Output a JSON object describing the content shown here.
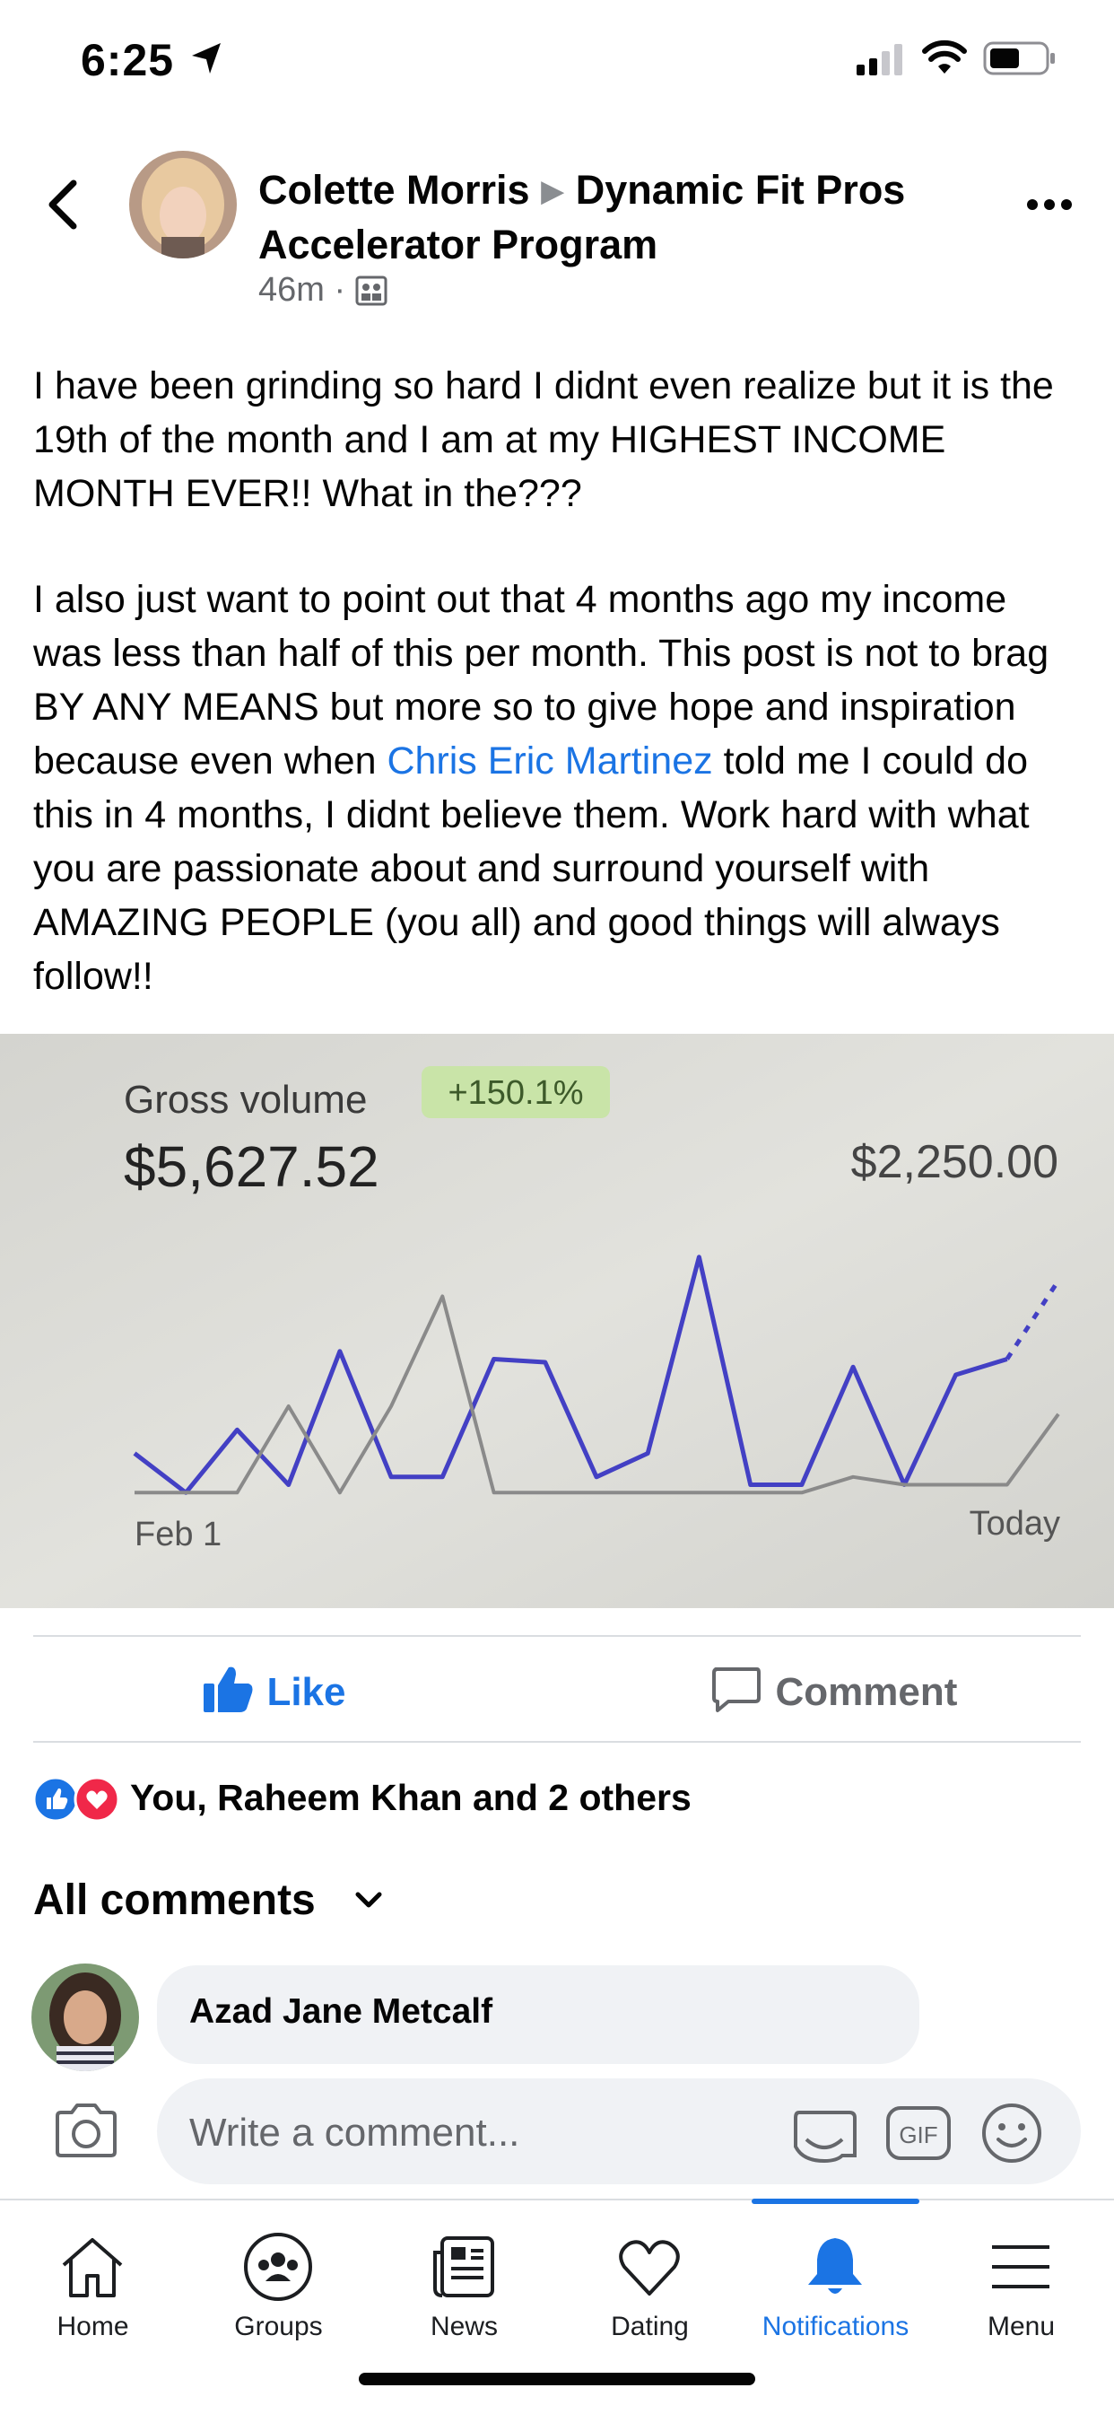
{
  "status_bar": {
    "time": "6:25"
  },
  "header": {
    "author": "Colette Morris",
    "group": "Dynamic Fit Pros Accelerator Program",
    "time_ago": "46m",
    "separator": "·"
  },
  "post": {
    "paragraph1": "I have been grinding so hard I didnt even realize but it is the 19th of the month and I am at my HIGHEST INCOME MONTH EVER!! What in the???",
    "paragraph2_before": "I also just want to point out that 4 months ago my income was less than half of this per month. This post is not to brag BY ANY MEANS but more so to give hope and inspiration because even when ",
    "mention": "Chris Eric Martinez",
    "paragraph2_after": " told me I could do this in 4 months, I didnt believe them. Work hard with what you are passionate about and surround yourself with AMAZING PEOPLE (you all) and good things will always follow!!"
  },
  "photo": {
    "label": "Gross volume",
    "badge": "+150.1%",
    "current_value": "$5,627.52",
    "previous_value": "$2,250.00",
    "colors": {
      "current": "#4340c4",
      "previous": "#8a8a8a",
      "badge_bg": "#c9e4a8"
    }
  },
  "chart_data": {
    "type": "line",
    "title": "Gross volume",
    "x_labels": [
      "Feb 1",
      "Today"
    ],
    "series": [
      {
        "values": [
          0.3,
          0.05,
          0.45,
          0.1,
          0.95,
          0.15,
          0.15,
          0.9,
          0.88,
          0.15,
          0.3,
          1.55,
          0.1,
          0.1,
          0.85,
          0.1,
          0.8,
          0.9,
          1.4
        ]
      },
      {
        "values": [
          0.05,
          0.05,
          0.05,
          0.6,
          0.05,
          0.6,
          1.3,
          0.05,
          0.05,
          0.05,
          0.05,
          0.05,
          0.05,
          0.05,
          0.15,
          0.1,
          0.1,
          0.1,
          0.55
        ]
      }
    ],
    "grid": false,
    "legend": "none"
  },
  "actions": {
    "like": "Like",
    "comment": "Comment"
  },
  "reactions": {
    "text": "You, Raheem Khan and 2 others"
  },
  "comments": {
    "header": "All comments",
    "first_author": "Azad Jane Metcalf"
  },
  "composer": {
    "placeholder": "Write a comment..."
  },
  "tabs": [
    {
      "label": "Home",
      "icon": "home-icon"
    },
    {
      "label": "Groups",
      "icon": "groups-icon"
    },
    {
      "label": "News",
      "icon": "news-icon"
    },
    {
      "label": "Dating",
      "icon": "dating-icon"
    },
    {
      "label": "Notifications",
      "icon": "bell-icon",
      "active": true
    },
    {
      "label": "Menu",
      "icon": "menu-icon"
    }
  ],
  "accent_color": "#1b74e4"
}
